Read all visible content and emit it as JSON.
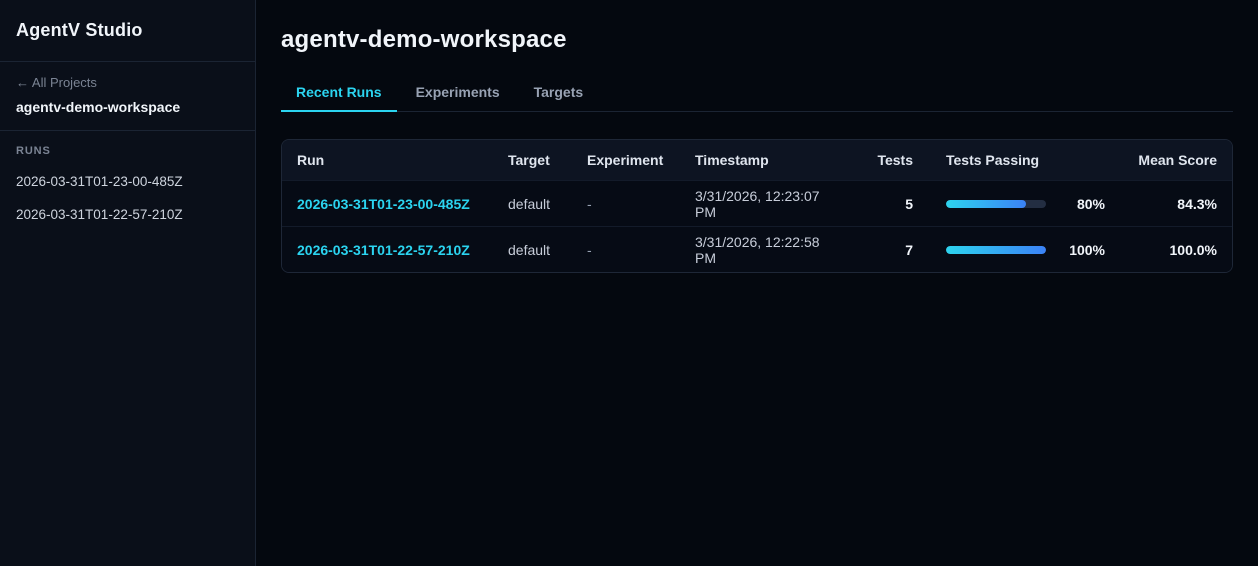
{
  "app": {
    "title": "AgentV Studio"
  },
  "sidebar": {
    "back_link": "← All Projects",
    "workspace": "agentv-demo-workspace",
    "runs_label": "RUNS",
    "runs": [
      "2026-03-31T01-23-00-485Z",
      "2026-03-31T01-22-57-210Z"
    ]
  },
  "main": {
    "title": "agentv-demo-workspace",
    "tabs": [
      {
        "label": "Recent Runs",
        "active": true
      },
      {
        "label": "Experiments",
        "active": false
      },
      {
        "label": "Targets",
        "active": false
      }
    ],
    "table": {
      "columns": [
        "Run",
        "Target",
        "Experiment",
        "Timestamp",
        "Tests",
        "Tests Passing",
        "Mean Score"
      ],
      "rows": [
        {
          "run": "2026-03-31T01-23-00-485Z",
          "target": "default",
          "experiment": "-",
          "timestamp": "3/31/2026, 12:23:07 PM",
          "tests": "5",
          "passing_pct": 80,
          "passing_label": "80%",
          "mean_score": "84.3%"
        },
        {
          "run": "2026-03-31T01-22-57-210Z",
          "target": "default",
          "experiment": "-",
          "timestamp": "3/31/2026, 12:22:58 PM",
          "tests": "7",
          "passing_pct": 100,
          "passing_label": "100%",
          "mean_score": "100.0%"
        }
      ]
    }
  },
  "colors": {
    "accent": "#2bd4f0",
    "progress_from": "#2dd4ee",
    "progress_to": "#3b82f6"
  }
}
